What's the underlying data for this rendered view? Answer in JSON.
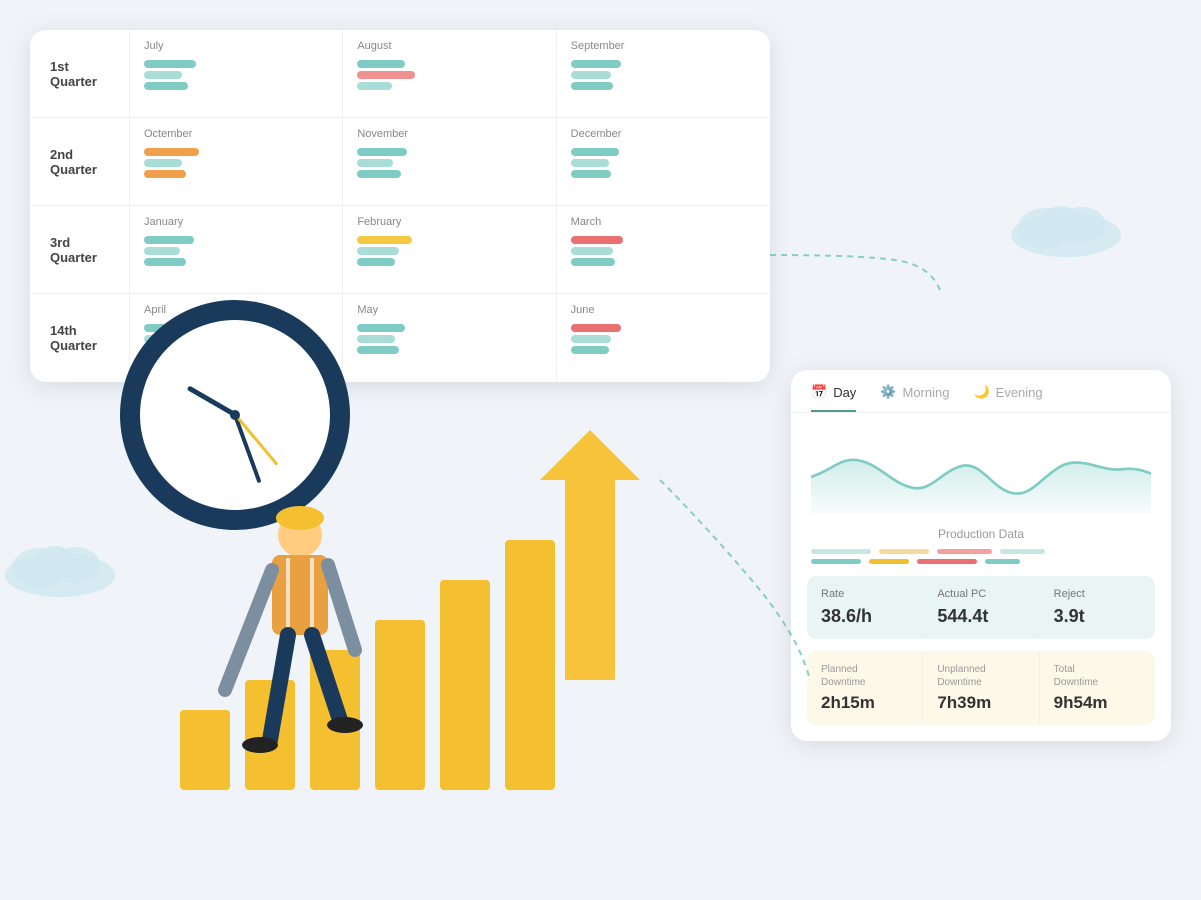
{
  "quarterly": {
    "quarters": [
      {
        "label": "1st\nQuarter",
        "months": [
          {
            "name": "July",
            "bars": [
              {
                "color": "teal",
                "width": 52
              },
              {
                "color": "teal2",
                "width": 38
              },
              {
                "color": "teal",
                "width": 44
              }
            ]
          },
          {
            "name": "August",
            "bars": [
              {
                "color": "teal",
                "width": 48
              },
              {
                "color": "pink",
                "width": 58
              },
              {
                "color": "teal2",
                "width": 35
              }
            ]
          },
          {
            "name": "September",
            "bars": [
              {
                "color": "teal",
                "width": 50
              },
              {
                "color": "teal2",
                "width": 40
              },
              {
                "color": "teal",
                "width": 42
              }
            ]
          }
        ]
      },
      {
        "label": "2nd\nQuarter",
        "months": [
          {
            "name": "Octember",
            "bars": [
              {
                "color": "orange",
                "width": 55
              },
              {
                "color": "teal2",
                "width": 38
              },
              {
                "color": "orange",
                "width": 42
              }
            ]
          },
          {
            "name": "November",
            "bars": [
              {
                "color": "teal",
                "width": 50
              },
              {
                "color": "teal2",
                "width": 36
              },
              {
                "color": "teal",
                "width": 44
              }
            ]
          },
          {
            "name": "December",
            "bars": [
              {
                "color": "teal",
                "width": 48
              },
              {
                "color": "teal2",
                "width": 38
              },
              {
                "color": "teal",
                "width": 40
              }
            ]
          }
        ]
      },
      {
        "label": "3rd\nQuarter",
        "months": [
          {
            "name": "January",
            "bars": [
              {
                "color": "teal",
                "width": 50
              },
              {
                "color": "teal2",
                "width": 36
              },
              {
                "color": "teal",
                "width": 42
              }
            ]
          },
          {
            "name": "February",
            "bars": [
              {
                "color": "yellow",
                "width": 55
              },
              {
                "color": "teal2",
                "width": 42
              },
              {
                "color": "teal",
                "width": 38
              }
            ]
          },
          {
            "name": "March",
            "bars": [
              {
                "color": "red",
                "width": 52
              },
              {
                "color": "teal2",
                "width": 42
              },
              {
                "color": "teal",
                "width": 44
              }
            ]
          }
        ]
      },
      {
        "label": "14th\nQuarter",
        "months": [
          {
            "name": "April",
            "bars": [
              {
                "color": "teal",
                "width": 46
              },
              {
                "color": "teal2",
                "width": 36
              },
              {
                "color": "teal",
                "width": 40
              }
            ]
          },
          {
            "name": "May",
            "bars": [
              {
                "color": "teal",
                "width": 48
              },
              {
                "color": "teal2",
                "width": 38
              },
              {
                "color": "teal",
                "width": 42
              }
            ]
          },
          {
            "name": "June",
            "bars": [
              {
                "color": "red",
                "width": 50
              },
              {
                "color": "teal2",
                "width": 40
              },
              {
                "color": "teal",
                "width": 38
              }
            ]
          }
        ]
      }
    ]
  },
  "production": {
    "tabs": [
      {
        "label": "Day",
        "icon": "📅",
        "active": true
      },
      {
        "label": "Morning",
        "icon": "⚙️",
        "active": false
      },
      {
        "label": "Evening",
        "icon": "🌙",
        "active": false
      }
    ],
    "chart_title": "Production Data",
    "stats": [
      {
        "label": "Rate",
        "value": "38.6/h"
      },
      {
        "label": "Actual PC",
        "value": "544.4t"
      },
      {
        "label": "Reject",
        "value": "3.9t"
      }
    ],
    "downtime": [
      {
        "label": "Planned\nDowntime",
        "value": "2h15m"
      },
      {
        "label": "Unplanned\nDowntime",
        "value": "7h39m"
      },
      {
        "label": "Total\nDowntime",
        "value": "9h54m"
      }
    ]
  }
}
